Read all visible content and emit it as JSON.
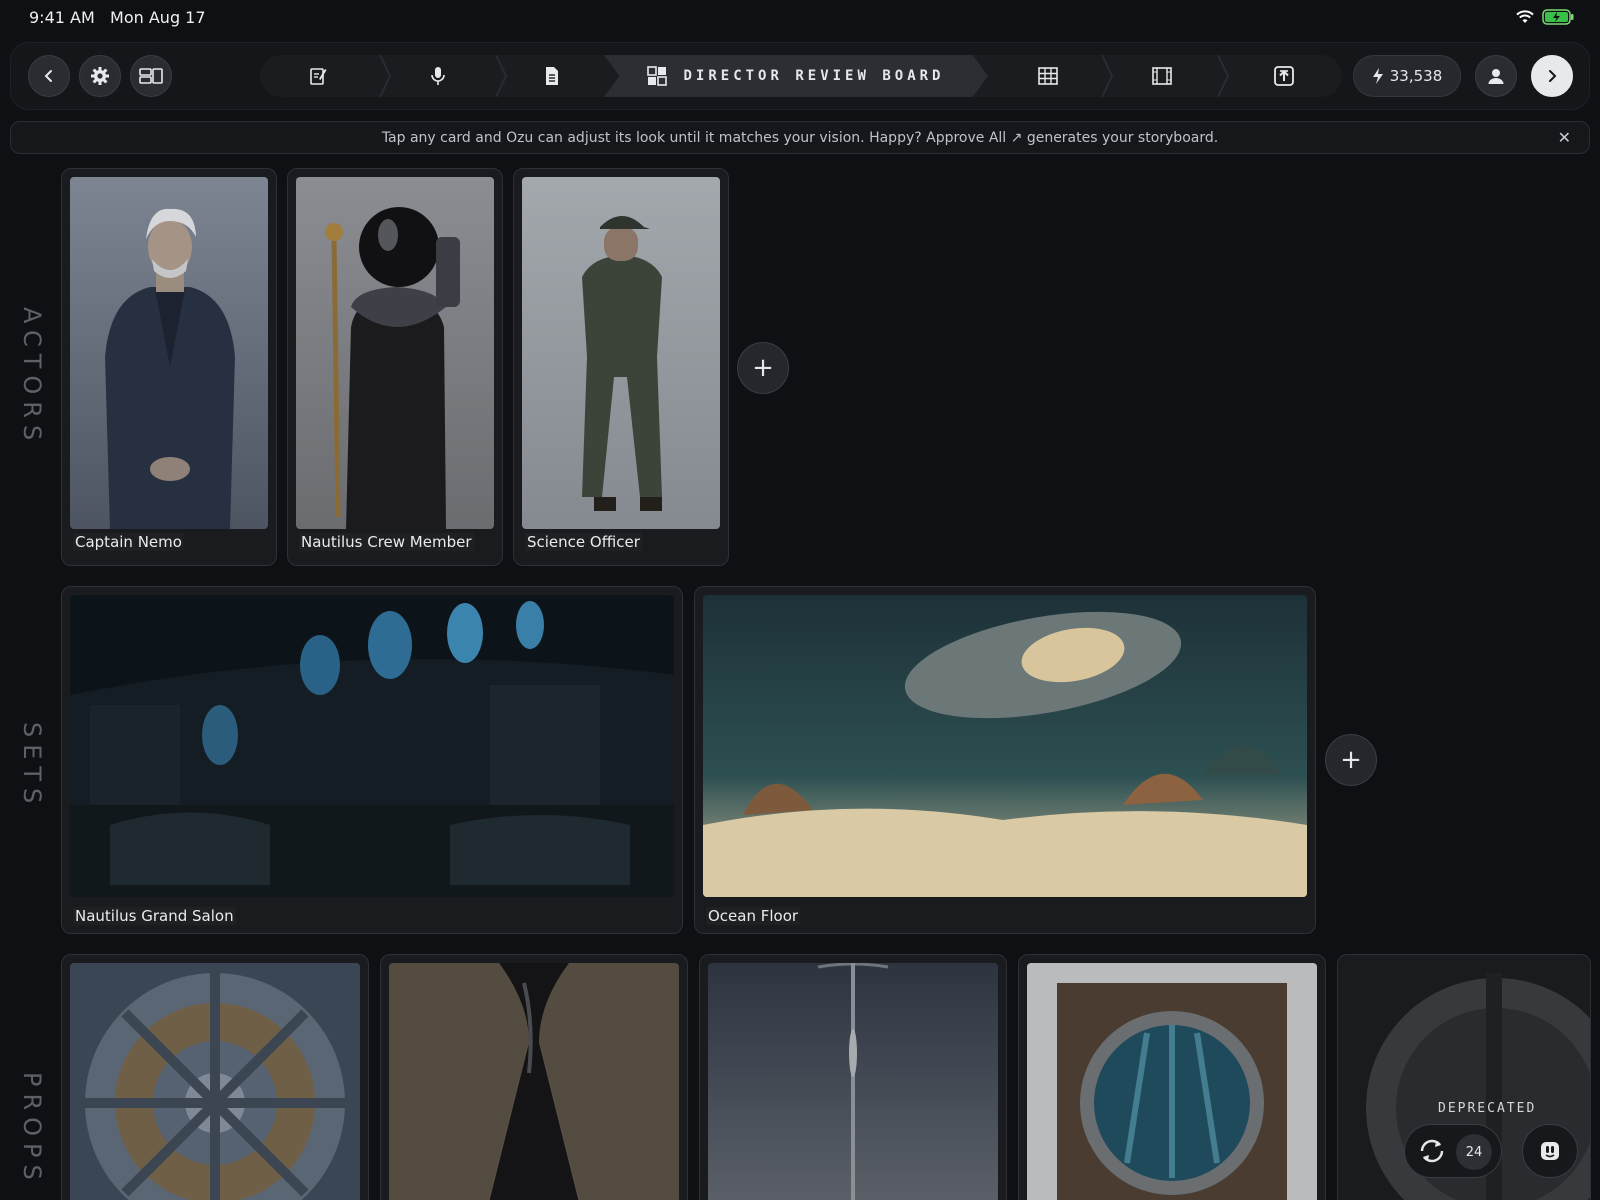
{
  "status_bar": {
    "time": "9:41 AM",
    "date": "Mon Aug 17",
    "icons": [
      "wifi-icon",
      "battery-charging-icon"
    ]
  },
  "toolbar": {
    "left_buttons": [
      "back-icon",
      "settings-icon",
      "layout-toggle-icon"
    ],
    "pipeline_steps": [
      {
        "name": "script-edit-icon"
      },
      {
        "name": "microphone-icon"
      },
      {
        "name": "document-icon"
      },
      {
        "name": "review-board-icon",
        "label": "DIRECTOR REVIEW BOARD",
        "active": true
      },
      {
        "name": "table-icon"
      },
      {
        "name": "filmstrip-icon"
      },
      {
        "name": "export-icon"
      }
    ],
    "credits": "33,538",
    "right_buttons": [
      "profile-icon",
      "forward-icon"
    ]
  },
  "banner": {
    "text": "Tap any card and Ozu can adjust its look until it matches your vision. Happy? Approve All ↗ generates your storyboard.",
    "close": "✕"
  },
  "sections": {
    "actors": {
      "label": "ACTORS",
      "cards": [
        {
          "label": "Captain Nemo"
        },
        {
          "label": "Nautilus Crew Member"
        },
        {
          "label": "Science Officer"
        }
      ],
      "add": "+"
    },
    "sets": {
      "label": "SETS",
      "cards": [
        {
          "label": "Nautilus Grand Salon"
        },
        {
          "label": "Ocean Floor"
        }
      ],
      "add": "+"
    },
    "props": {
      "label": "PROPS",
      "cards": [
        {
          "label": ""
        },
        {
          "label": ""
        },
        {
          "label": ""
        },
        {
          "label": ""
        },
        {
          "badge": "DEPRECATED"
        }
      ]
    }
  },
  "controls": {
    "regenerate_count": "24"
  }
}
